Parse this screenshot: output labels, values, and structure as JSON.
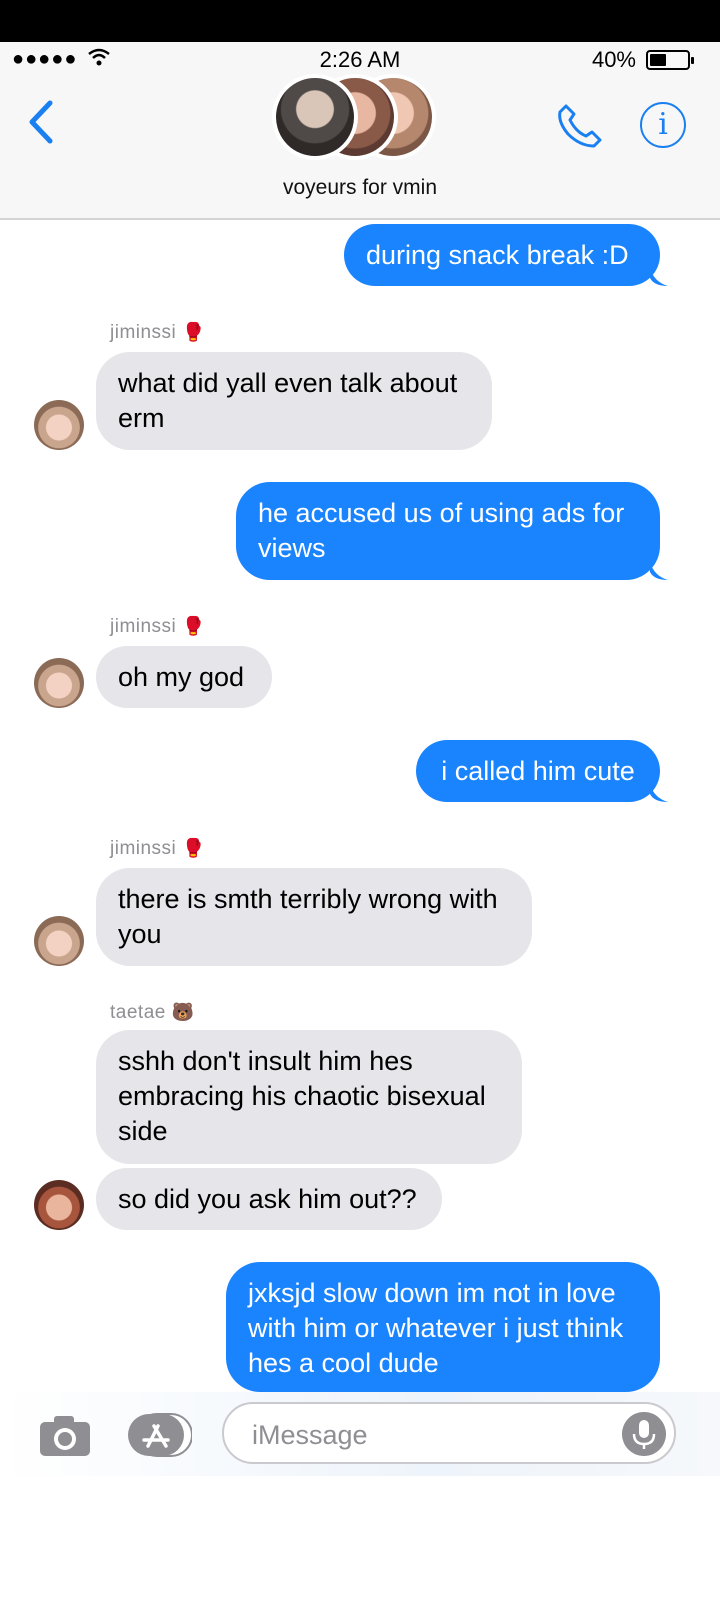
{
  "status_bar": {
    "time": "2:26 AM",
    "battery": "40%",
    "signal": "●●●●●",
    "battery_level": 0.4
  },
  "header": {
    "group_name": "voyeurs for vmin",
    "icons": [
      "back-chevron-icon",
      "phone-icon",
      "info-icon"
    ]
  },
  "messages": [
    {
      "type": "sent",
      "text": "during snack break :D"
    },
    {
      "type": "recv",
      "sender": "jiminssi",
      "sender_emoji": "🥊",
      "text": "what did yall even talk about erm"
    },
    {
      "type": "sent",
      "text": "he accused us of using ads for views"
    },
    {
      "type": "recv",
      "sender": "jiminssi",
      "sender_emoji": "🥊",
      "text": "oh my god"
    },
    {
      "type": "sent",
      "text": "i called him cute"
    },
    {
      "type": "recv",
      "sender": "jiminssi",
      "sender_emoji": "🥊",
      "text": "there is smth terribly wrong with you"
    },
    {
      "type": "recv",
      "sender": "taetae",
      "sender_emoji": "🐻",
      "text": "sshh don't insult him hes embracing his chaotic bisexual side"
    },
    {
      "type": "recv",
      "text": "so did you ask him out??"
    },
    {
      "type": "sent",
      "text": "jxksjd slow down im not in love with him or whatever i just think hes a cool dude"
    }
  ],
  "composer": {
    "placeholder": "iMessage",
    "icons": [
      "camera-icon",
      "app-store-icon",
      "microphone-icon"
    ]
  },
  "colors": {
    "sent_bubble": "#1a84ff",
    "recv_bubble": "#e5e5ea",
    "accent": "#1a7ff0"
  }
}
